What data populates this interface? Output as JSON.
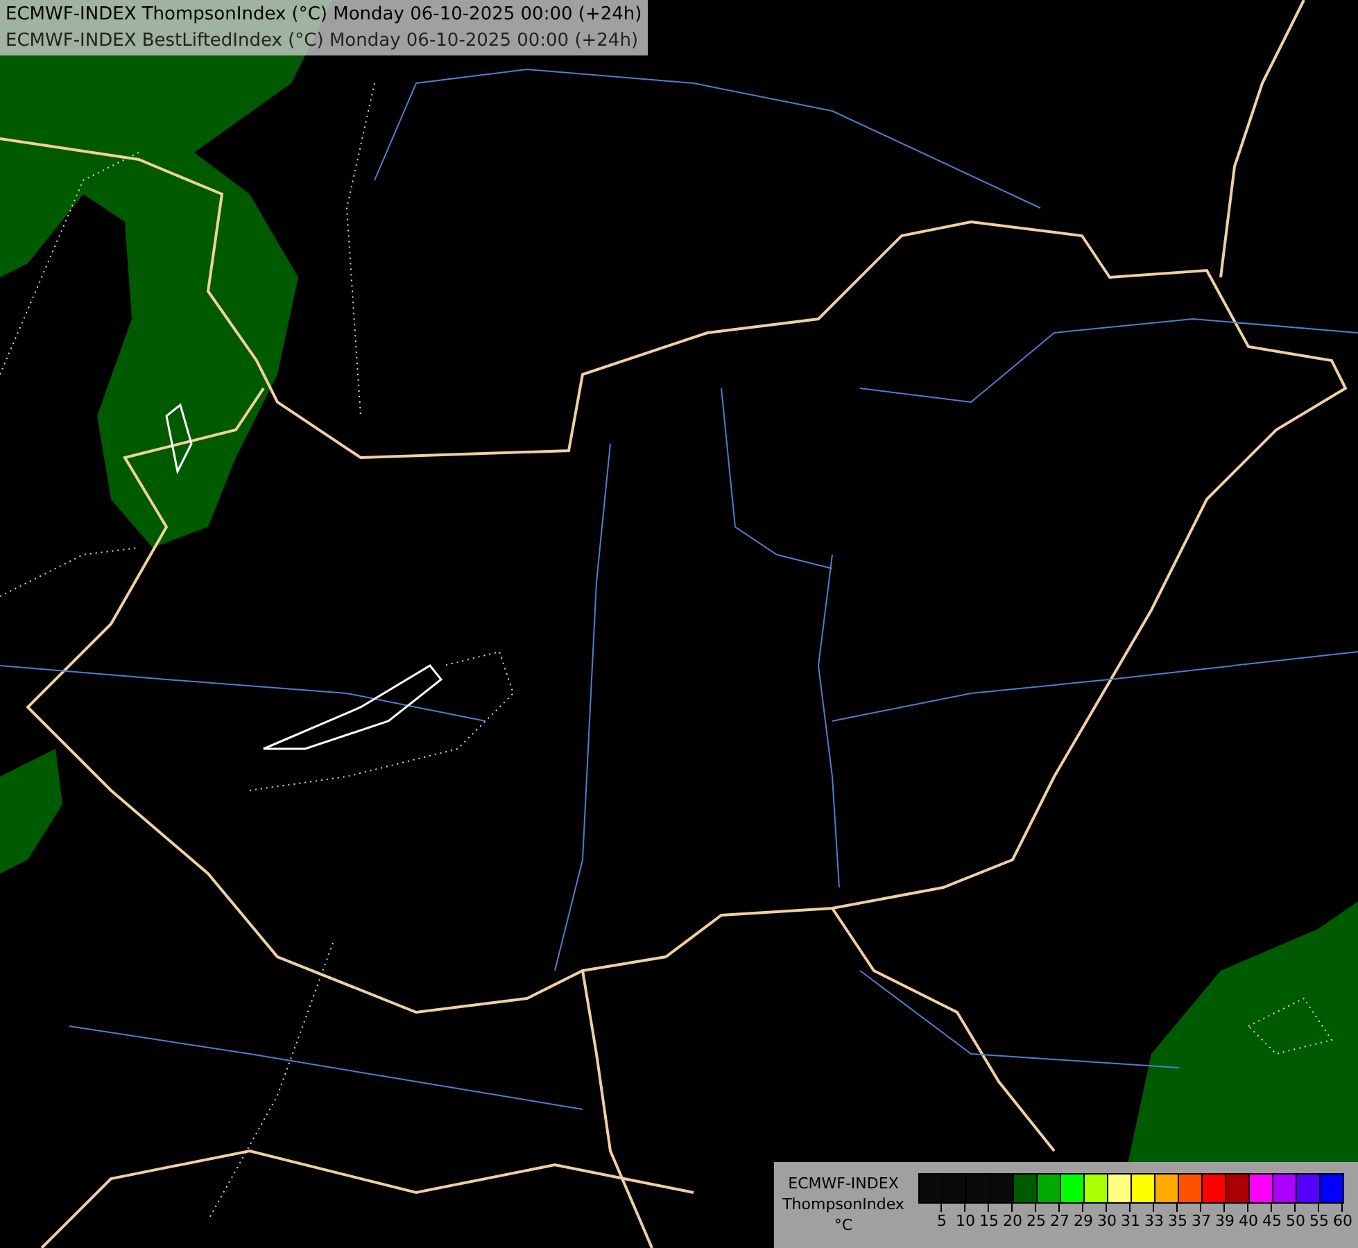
{
  "header": {
    "lines": [
      "ECMWF-INDEX ThompsonIndex (°C) Monday 06-10-2025 00:00 (+24h)",
      "ECMWF-INDEX BestLiftedIndex (°C) Monday 06-10-2025 00:00 (+24h)"
    ]
  },
  "legend": {
    "title_lines": [
      "ECMWF-INDEX",
      "ThompsonIndex",
      "°C"
    ],
    "bins": [
      {
        "color": "#0a0a0a",
        "label": "5"
      },
      {
        "color": "#0a0a0a",
        "label": "10"
      },
      {
        "color": "#0a0a0a",
        "label": "15"
      },
      {
        "color": "#0a0a0a",
        "label": "20"
      },
      {
        "color": "#005a00",
        "label": "25"
      },
      {
        "color": "#00aa00",
        "label": "27"
      },
      {
        "color": "#00ff00",
        "label": "29"
      },
      {
        "color": "#aaff00",
        "label": "30"
      },
      {
        "color": "#ffff80",
        "label": "31"
      },
      {
        "color": "#ffff00",
        "label": "33"
      },
      {
        "color": "#ffaa00",
        "label": "35"
      },
      {
        "color": "#ff5000",
        "label": "37"
      },
      {
        "color": "#ff0000",
        "label": "39"
      },
      {
        "color": "#aa0000",
        "label": "40"
      },
      {
        "color": "#ff00ff",
        "label": "45"
      },
      {
        "color": "#aa00ff",
        "label": "50"
      },
      {
        "color": "#5500ff",
        "label": "55"
      },
      {
        "color": "#0000ff",
        "label": "60"
      }
    ]
  }
}
